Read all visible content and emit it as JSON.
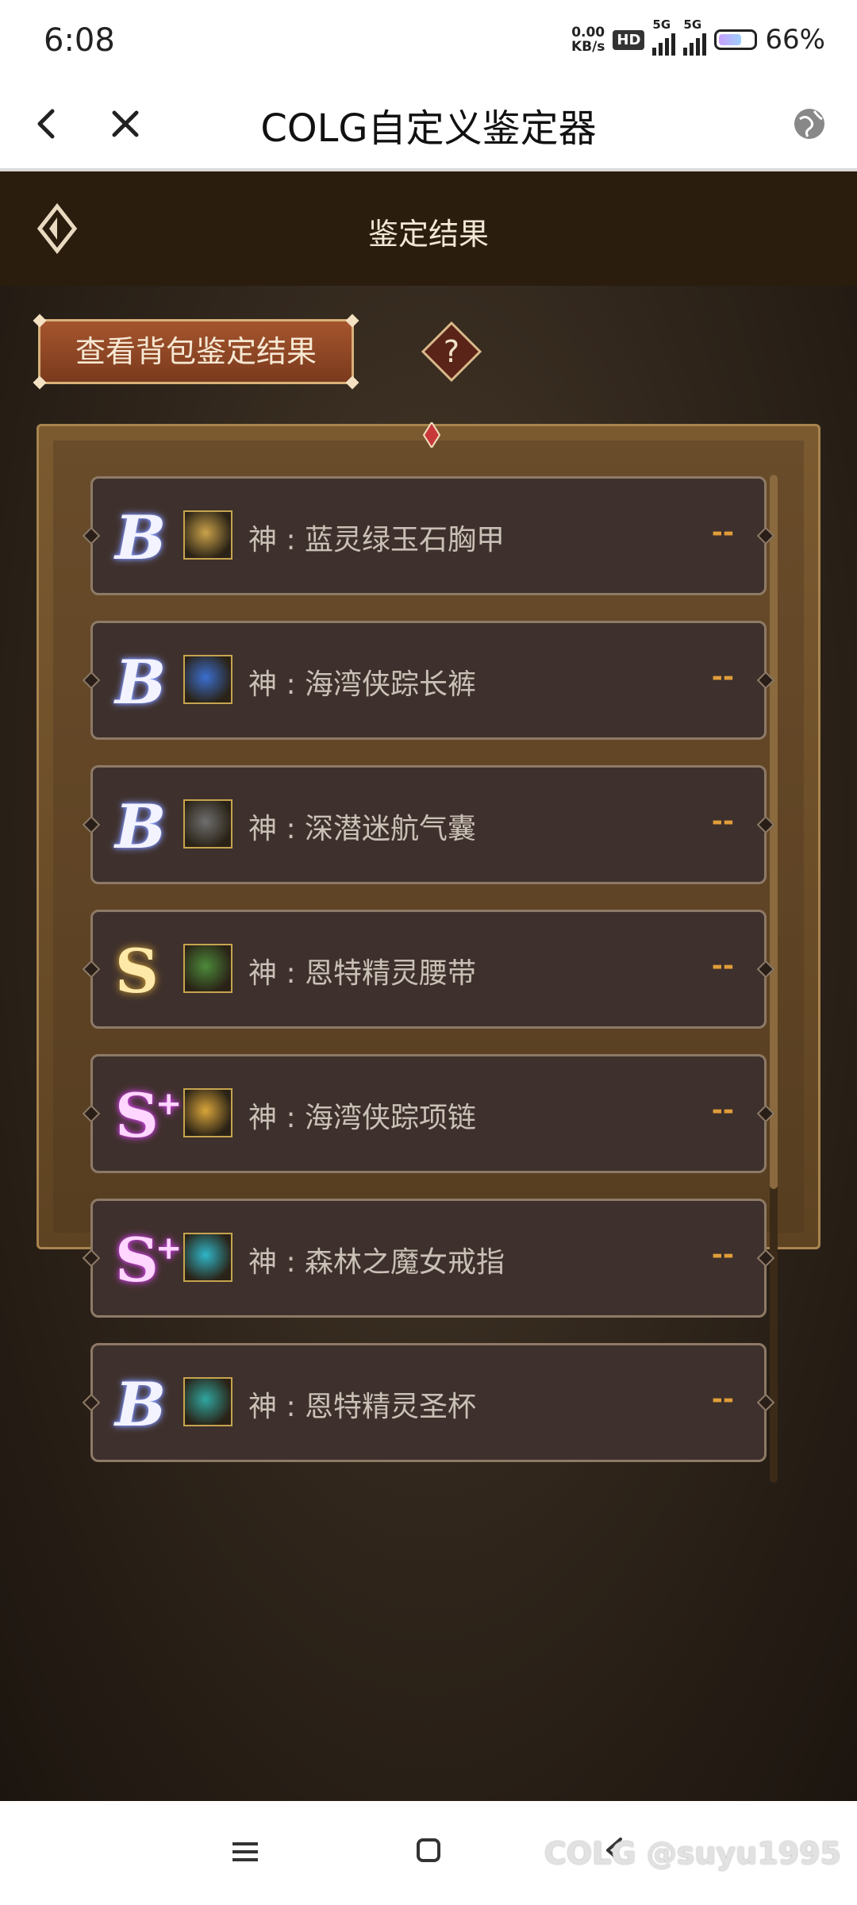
{
  "status_bar": {
    "time": "6:08",
    "speed_value": "0.00",
    "speed_unit": "KB/s",
    "hd_badge": "HD",
    "net1": "5G",
    "net2": "5G",
    "battery": "66%",
    "battery_level": 0.66
  },
  "titlebar": {
    "title": "COLG自定义鉴定器",
    "back_icon": "chevron-left-icon",
    "close_icon": "close-icon",
    "globe_icon": "globe-icon"
  },
  "game": {
    "header_title": "鉴定结果",
    "bag_button": "查看背包鉴定结果",
    "help_icon": "question-icon",
    "items": [
      {
        "grade": "B",
        "plus": "",
        "name": "神 : 蓝灵绿玉石胸甲",
        "score": "--",
        "icon": "chest-armor-icon",
        "icon_color": "#caa24a"
      },
      {
        "grade": "B",
        "plus": "",
        "name": "神 : 海湾侠踪长裤",
        "score": "--",
        "icon": "pants-icon",
        "icon_color": "#3b6fd0"
      },
      {
        "grade": "B",
        "plus": "",
        "name": "神 : 深潜迷航气囊",
        "score": "--",
        "icon": "shoulder-icon",
        "icon_color": "#6e6e6e"
      },
      {
        "grade": "S",
        "plus": "",
        "name": "神 : 恩特精灵腰带",
        "score": "--",
        "icon": "belt-icon",
        "icon_color": "#4c8a3a"
      },
      {
        "grade": "S",
        "plus": "+",
        "name": "神 : 海湾侠踪项链",
        "score": "--",
        "icon": "necklace-icon",
        "icon_color": "#d9a53a"
      },
      {
        "grade": "S",
        "plus": "+",
        "name": "神 : 森林之魔女戒指",
        "score": "--",
        "icon": "ring-icon",
        "icon_color": "#2fb6c8"
      },
      {
        "grade": "B",
        "plus": "",
        "name": "神 : 恩特精灵圣杯",
        "score": "--",
        "icon": "chalice-icon",
        "icon_color": "#2fa6a0"
      }
    ]
  },
  "navbar": {
    "menu_icon": "menu-icon",
    "home_icon": "home-square-icon",
    "back_icon": "back-icon",
    "watermark": "COLG @suyu1995"
  }
}
